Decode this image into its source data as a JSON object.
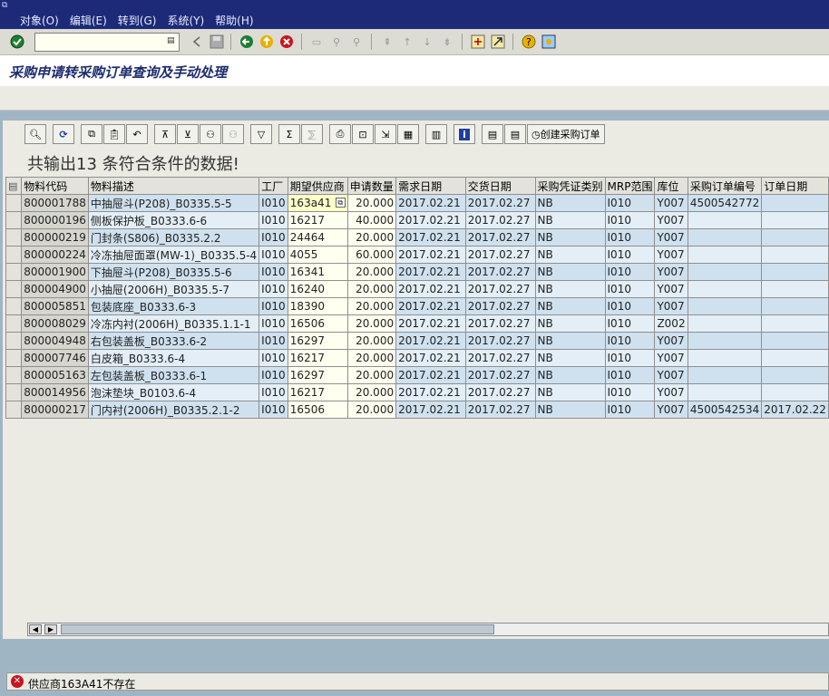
{
  "menubar": {
    "items": [
      "对象(O)",
      "编辑(E)",
      "转到(G)",
      "系统(Y)",
      "帮助(H)"
    ]
  },
  "toolbar": {
    "command_value": ""
  },
  "title": "采购申请转采购订单查询及手动处理",
  "alv": {
    "create_po_label": "创建采购订单",
    "heading": "共输出13 条符合条件的数据!",
    "columns": [
      "物料代码",
      "物料描述",
      "工厂",
      "期望供应商",
      "申请数量",
      "需求日期",
      "交货日期",
      "采购凭证类别",
      "MRP范围",
      "库位",
      "采购订单编号",
      "订单日期"
    ],
    "rows": [
      [
        "800001788",
        "中抽屉斗(P208)_B0335.5-5",
        "I010",
        "163a41",
        "20.000",
        "2017.02.21",
        "2017.02.27",
        "NB",
        "I010",
        "Y007",
        "4500542772",
        ""
      ],
      [
        "800000196",
        "侧板保护板_B0333.6-6",
        "I010",
        "16217",
        "40.000",
        "2017.02.21",
        "2017.02.27",
        "NB",
        "I010",
        "Y007",
        "",
        ""
      ],
      [
        "800000219",
        "门封条(S806)_B0335.2.2",
        "I010",
        "24464",
        "20.000",
        "2017.02.21",
        "2017.02.27",
        "NB",
        "I010",
        "Y007",
        "",
        ""
      ],
      [
        "800000224",
        "冷冻抽屉面罩(MW-1)_B0335.5-4",
        "I010",
        "4055",
        "60.000",
        "2017.02.21",
        "2017.02.27",
        "NB",
        "I010",
        "Y007",
        "",
        ""
      ],
      [
        "800001900",
        "下抽屉斗(P208)_B0335.5-6",
        "I010",
        "16341",
        "20.000",
        "2017.02.21",
        "2017.02.27",
        "NB",
        "I010",
        "Y007",
        "",
        ""
      ],
      [
        "800004900",
        "小抽屉(2006H)_B0335.5-7",
        "I010",
        "16240",
        "20.000",
        "2017.02.21",
        "2017.02.27",
        "NB",
        "I010",
        "Y007",
        "",
        ""
      ],
      [
        "800005851",
        "包装底座_B0333.6-3",
        "I010",
        "18390",
        "20.000",
        "2017.02.21",
        "2017.02.27",
        "NB",
        "I010",
        "Y007",
        "",
        ""
      ],
      [
        "800008029",
        "冷冻内衬(2006H)_B0335.1.1-1",
        "I010",
        "16506",
        "20.000",
        "2017.02.21",
        "2017.02.27",
        "NB",
        "I010",
        "Z002",
        "",
        ""
      ],
      [
        "800004948",
        "右包装盖板_B0333.6-2",
        "I010",
        "16297",
        "20.000",
        "2017.02.21",
        "2017.02.27",
        "NB",
        "I010",
        "Y007",
        "",
        ""
      ],
      [
        "800007746",
        "白皮箱_B0333.6-4",
        "I010",
        "16217",
        "20.000",
        "2017.02.21",
        "2017.02.27",
        "NB",
        "I010",
        "Y007",
        "",
        ""
      ],
      [
        "800005163",
        "左包装盖板_B0333.6-1",
        "I010",
        "16297",
        "20.000",
        "2017.02.21",
        "2017.02.27",
        "NB",
        "I010",
        "Y007",
        "",
        ""
      ],
      [
        "800014956",
        "泡沫垫块_B0103.6-4",
        "I010",
        "16217",
        "20.000",
        "2017.02.21",
        "2017.02.27",
        "NB",
        "I010",
        "Y007",
        "",
        ""
      ],
      [
        "800000217",
        "门内衬(2006H)_B0335.2.1-2",
        "I010",
        "16506",
        "20.000",
        "2017.02.21",
        "2017.02.27",
        "NB",
        "I010",
        "Y007",
        "4500542534",
        "2017.02.22"
      ]
    ]
  },
  "status": {
    "message": "供应商163A41不存在"
  },
  "colors": {
    "menubar": "#1d2a78",
    "row_dark": "#cfe1ef",
    "row_light": "#e3eef6",
    "error": "#c8141e"
  }
}
